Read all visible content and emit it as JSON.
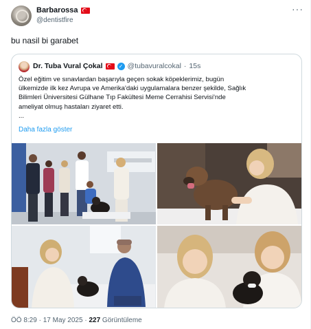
{
  "post": {
    "author_name": "Barbarossa",
    "author_handle": "@dentistfire",
    "more_label": "···",
    "text": "bu nasil bi garabet"
  },
  "quote": {
    "author_name": "Dr. Tuba Vural Çokal",
    "author_handle": "@tubavuralcokal",
    "separator": "·",
    "time": "15s",
    "body": [
      "Özel eğitim ve sınavlardan başarıyla geçen sokak köpeklerimiz, bugün",
      "ülkemizde ilk kez Avrupa ve Amerika'daki uygulamalara benzer şekilde, Sağlık",
      "Bilimleri Üniversitesi Gülhane Tıp Fakültesi Meme Cerrahisi Servisi'nde",
      "ameliyat olmuş hastaları ziyaret etti.",
      "..."
    ],
    "show_more": "Daha fazla göster"
  },
  "footer": {
    "time": "ÖÖ 8:29",
    "date": "17 May 2025",
    "separator": "·",
    "views_count": "227",
    "views_label": "Görüntüleme"
  },
  "colors": {
    "link": "#1d9bf0",
    "secondary_text": "#536471",
    "flag_red": "#e30a17"
  }
}
